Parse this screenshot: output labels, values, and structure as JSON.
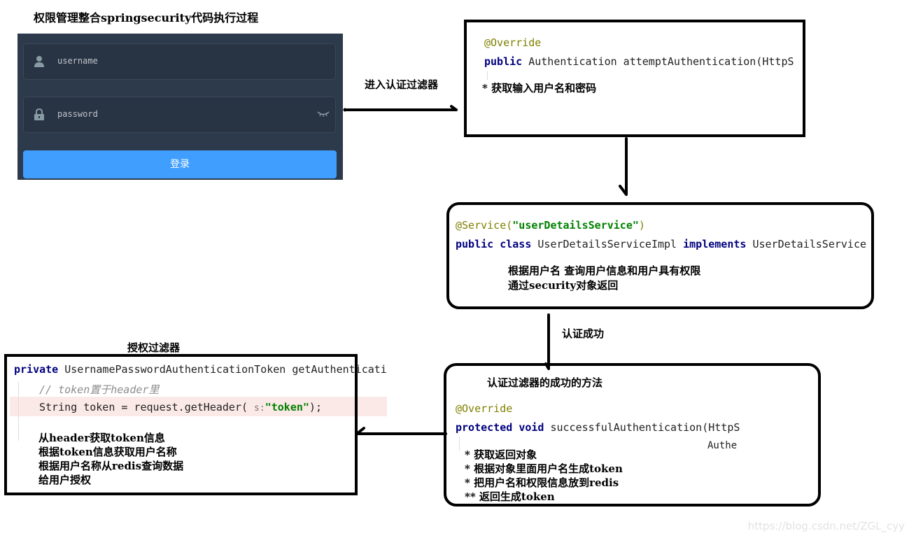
{
  "title": "权限管理整合springsecurity代码执行过程",
  "login_form": {
    "username_placeholder": "username",
    "password_placeholder": "password",
    "login_button": "登录",
    "icons": [
      "user-icon",
      "lock-icon",
      "eye-closed-icon"
    ],
    "colors": {
      "panel_bg": "#2d3a4b",
      "field_bg": "#283443",
      "button_bg": "#409eff"
    }
  },
  "arrows": {
    "to_auth_filter_label": "进入认证过滤器",
    "auth_success_label": "认证成功"
  },
  "box_attempt": {
    "annotation": "@Override",
    "keyword": "public",
    "signature": "Authentication attemptAuthentication(HttpS",
    "notes": [
      "* 获取输入用户名和密码"
    ]
  },
  "box_userdetails": {
    "annotation_name": "@Service(",
    "annotation_value": "\"userDetailsService\"",
    "annotation_close": ")",
    "kw1": "public",
    "kw2": "class",
    "class_name": "UserDetailsServiceImpl",
    "kw3": "implements",
    "interface_name": "UserDetailsService",
    "notes": [
      "根据用户名 查询用户信息和用户具有权限",
      "通过security对象返回"
    ]
  },
  "box_success": {
    "heading": "认证过滤器的成功的方法",
    "annotation": "@Override",
    "kw1": "protected",
    "kw2": "void",
    "signature": "successfulAuthentication(HttpS",
    "continuation": "Authe",
    "notes": [
      "* 获取返回对象",
      "* 根据对象里面用户名生成token",
      "* 把用户名和权限信息放到redis",
      "** 返回生成token"
    ]
  },
  "box_authz": {
    "heading": "授权过滤器",
    "kw": "private",
    "signature": "UsernamePasswordAuthenticationToken getAuthenticati",
    "comment": "// token置于header里",
    "line_code": "String token = request.getHeader(",
    "param_hint": "s:",
    "string_value": "\"token\"",
    "line_end": ");",
    "notes": [
      "从header获取token信息",
      "根据token信息获取用户名称",
      "根据用户名称从redis查询数据",
      "给用户授权"
    ]
  },
  "watermark": "https://blog.csdn.net/ZGL_cyy"
}
